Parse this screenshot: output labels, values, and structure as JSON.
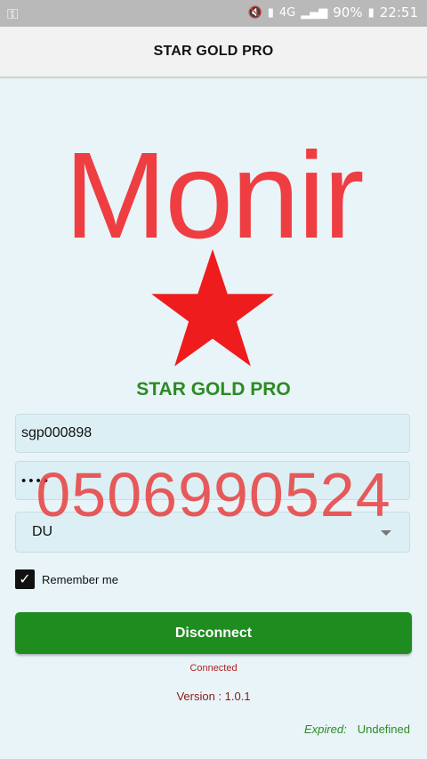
{
  "status_bar": {
    "key_icon": "key-icon",
    "battery": "90%",
    "time": "22:51",
    "network": "4G"
  },
  "app_bar": {
    "title": "STAR GOLD PRO"
  },
  "logo": {
    "text": "Monir",
    "star_icon": "star-icon",
    "color": "#ef3e42"
  },
  "brand": {
    "title": "STAR GOLD PRO",
    "color": "#2d8a24"
  },
  "form": {
    "username": "sgp000898",
    "password_masked": "••••",
    "watermark_text": "0506990524",
    "server": "DU",
    "remember_label": "Remember me",
    "remember_checked": true
  },
  "action": {
    "button_label": "Disconnect",
    "button_color": "#1f8c1f"
  },
  "footer": {
    "connection_status": "Connected",
    "version": "Version : 1.0.1",
    "expired_label": "Expired:",
    "expired_value": "Undefined"
  }
}
